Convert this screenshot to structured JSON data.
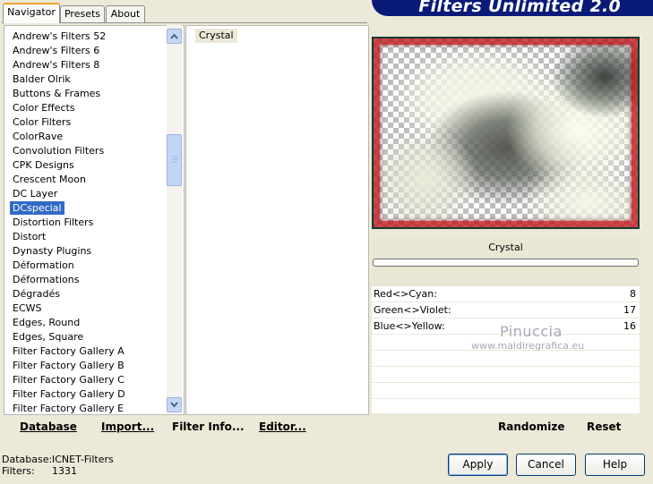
{
  "tabs": [
    {
      "label": "Navigator",
      "active": true
    },
    {
      "label": "Presets",
      "active": false
    },
    {
      "label": "About",
      "active": false
    }
  ],
  "banner": {
    "title": "Filters Unlimited 2.0"
  },
  "filter_list": {
    "items": [
      "Andrew's Filters 52",
      "Andrew's Filters 6",
      "Andrew's Filters 8",
      "Balder Olrik",
      "Buttons & Frames",
      "Color Effects",
      "Color Filters",
      "ColorRave",
      "Convolution Filters",
      "CPK Designs",
      "Crescent Moon",
      "DC Layer",
      "DCspecial",
      "Distortion Filters",
      "Distort",
      "Dynasty Plugins",
      "Déformation",
      "Déformations",
      "Dégradés",
      "ECWS",
      "Edges, Round",
      "Edges, Square",
      "Filter Factory Gallery A",
      "Filter Factory Gallery B",
      "Filter Factory Gallery C",
      "Filter Factory Gallery D",
      "Filter Factory Gallery E"
    ],
    "selected": "DCspecial"
  },
  "filters": {
    "items": [
      "Crystal"
    ]
  },
  "preview": {
    "filter_name": "Crystal"
  },
  "params": [
    {
      "label": "Red<>Cyan:",
      "value": "8"
    },
    {
      "label": "Green<>Violet:",
      "value": "17"
    },
    {
      "label": "Blue<>Yellow:",
      "value": "16"
    }
  ],
  "watermark": {
    "line1": "Pinuccia",
    "line2": "www.maidiregrafica.eu"
  },
  "toolbar": {
    "database": "Database",
    "import": "Import...",
    "filter_info": "Filter Info...",
    "editor": "Editor...",
    "randomize": "Randomize",
    "reset": "Reset"
  },
  "status": {
    "database_label": "Database:",
    "database_value": "ICNET-Filters",
    "filters_label": "Filters:",
    "filters_value": "1331"
  },
  "dialog_buttons": {
    "apply": "Apply",
    "cancel": "Cancel",
    "help": "Help"
  },
  "colors": {
    "selection": "#316ac5",
    "banner": "#0a1a78",
    "frame_red": "#d01818"
  }
}
